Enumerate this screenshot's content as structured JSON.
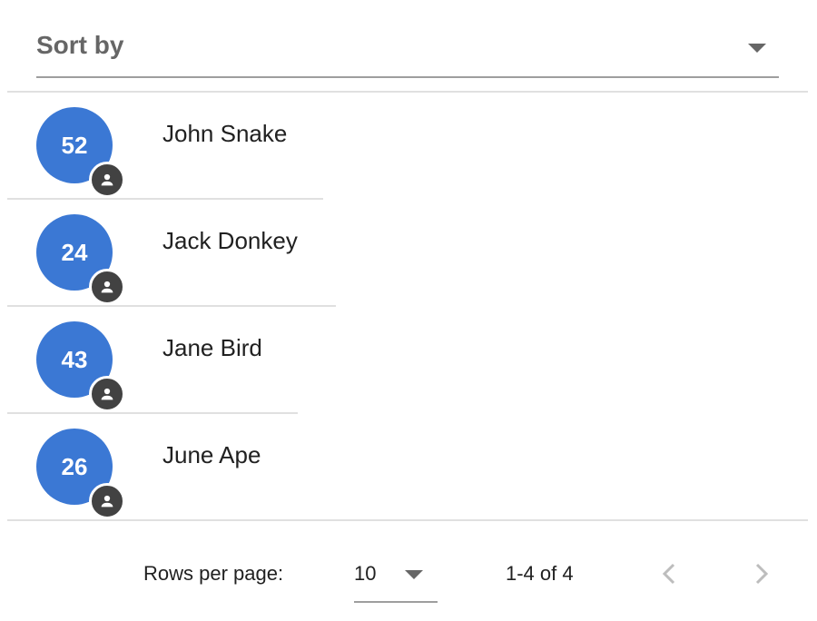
{
  "sort": {
    "label": "Sort by"
  },
  "people": [
    {
      "age": "52",
      "name": "John Snake"
    },
    {
      "age": "24",
      "name": "Jack Donkey"
    },
    {
      "age": "43",
      "name": "Jane Bird"
    },
    {
      "age": "26",
      "name": "June Ape"
    }
  ],
  "pagination": {
    "rows_label": "Rows per page:",
    "rows_value": "10",
    "range": "1-4 of 4"
  },
  "colors": {
    "avatar": "#3b78d4",
    "badge": "#424242",
    "divider": "#e0e0e0"
  }
}
